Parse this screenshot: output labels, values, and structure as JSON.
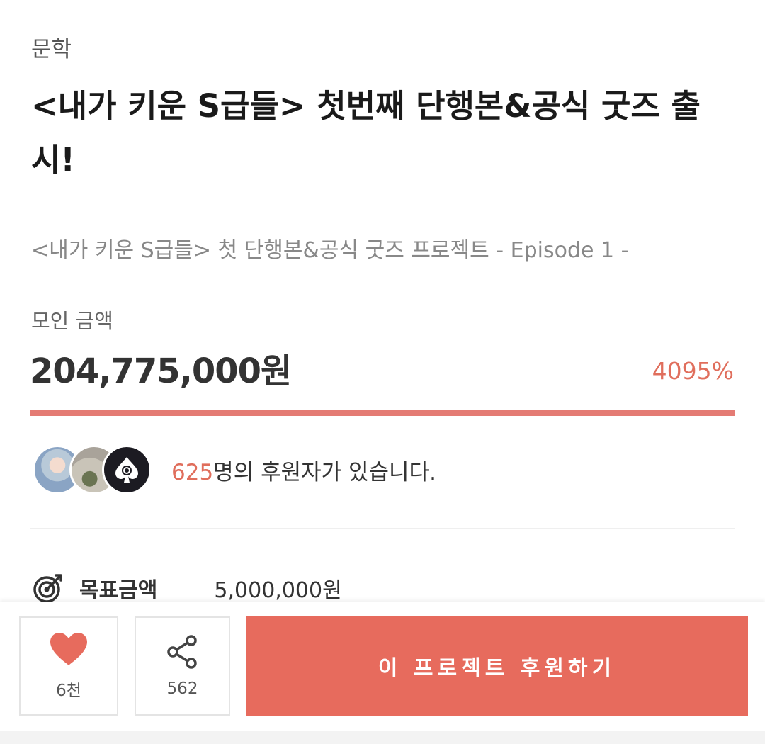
{
  "project": {
    "category": "문학",
    "title": "<내가 키운 S급들> 첫번째 단행본&공식 굿즈 출시!",
    "subtitle": "<내가 키운 S급들> 첫 단행본&공식 굿즈 프로젝트 - Episode 1 -"
  },
  "funding": {
    "amount_label": "모인 금액",
    "amount": "204,775,000원",
    "percent": "4095%",
    "progress_fraction": 1.0,
    "accent_color": "#e06e5c",
    "bar_color": "#e47b74"
  },
  "backers": {
    "count": "625",
    "suffix": "명의 후원자가 있습니다."
  },
  "goal": {
    "icon": "target-icon",
    "label": "목표금액",
    "value": "5,000,000원"
  },
  "actions": {
    "like_icon": "heart-icon",
    "like_count": "6천",
    "share_icon": "share-icon",
    "share_count": "562",
    "support_label": "이 프로젝트 후원하기",
    "support_color": "#e76b5d"
  }
}
